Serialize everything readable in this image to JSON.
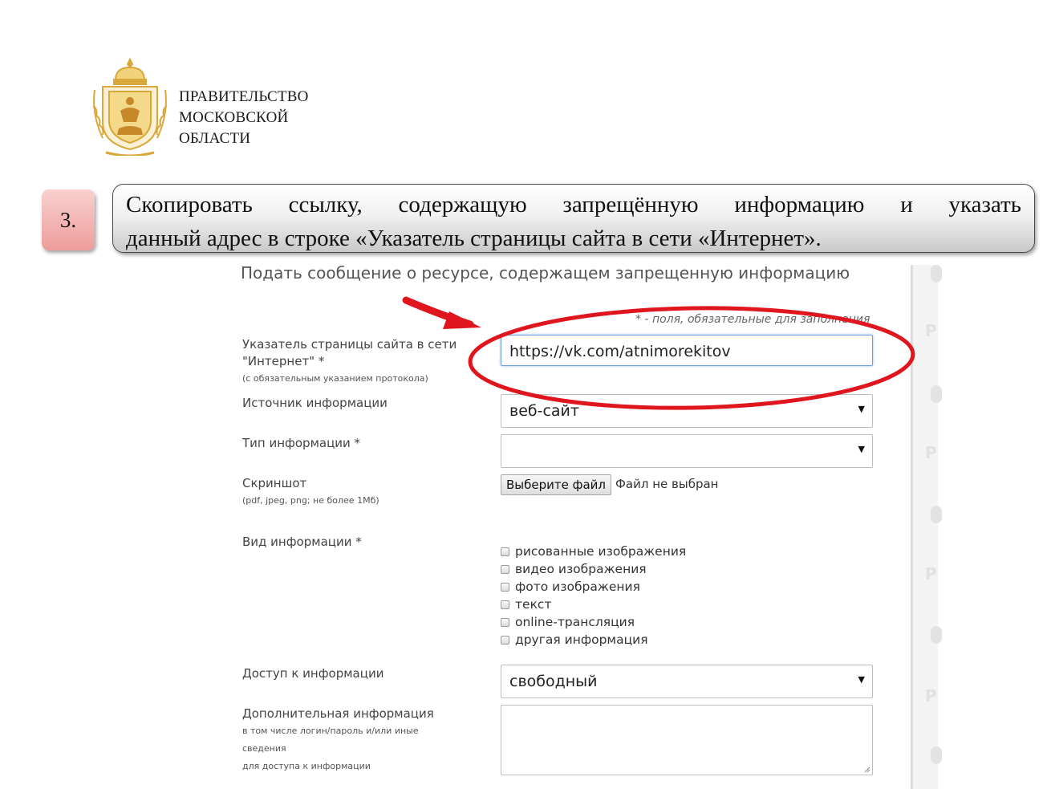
{
  "header": {
    "org_line1": "ПРАВИТЕЛЬСТВО",
    "org_line2": "МОСКОВСКОЙ",
    "org_line3": "ОБЛАСТИ"
  },
  "step": {
    "number": "3.",
    "line1_words": [
      "Скопировать",
      "ссылку,",
      "содержащую",
      "запрещённую",
      "информацию",
      "и",
      "указать"
    ],
    "line2": "данный адрес в строке «Указатель страницы сайта в сети «Интернет»."
  },
  "form": {
    "heading": "Подать сообщение о ресурсе, содержащем запрещенную информацию",
    "required_note": "* - поля, обязательные для заполнения",
    "url": {
      "label_line1": "Указатель страницы сайта в сети",
      "label_line2": "\"Интернет\" *",
      "hint": "(с обязательным указанием протокола)",
      "value": "https://vk.com/atnimorekitov"
    },
    "source": {
      "label": "Источник информации",
      "value": "веб-сайт"
    },
    "info_type": {
      "label": "Тип информации *",
      "value": ""
    },
    "screenshot": {
      "label": "Скриншот",
      "hint": "(pdf, jpeg, png; не более 1Мб)",
      "button_label": "Выберите файл",
      "status": "Файл не выбран"
    },
    "kind": {
      "label": "Вид информации *",
      "options": [
        "рисованные изображения",
        "видео изображения",
        "фото изображения",
        "текст",
        "online-трансляция",
        "другая информация"
      ]
    },
    "access": {
      "label": "Доступ к информации",
      "value": "свободный"
    },
    "extra": {
      "label": "Дополнительная информация",
      "hint_line1": "в том числе логин/пароль и/или иные",
      "hint_line2": "сведения",
      "hint_line3": "для доступа к информации",
      "value": ""
    }
  },
  "colors": {
    "badge": "#ee9d9b",
    "annotation_red": "#e0161f",
    "emblem_gold": "#d9a83a",
    "focus_border": "#6aa0d8"
  },
  "icons": {
    "emblem": "moscow-oblast-coat-of-arms",
    "dropdown": "triangle-down-icon"
  }
}
